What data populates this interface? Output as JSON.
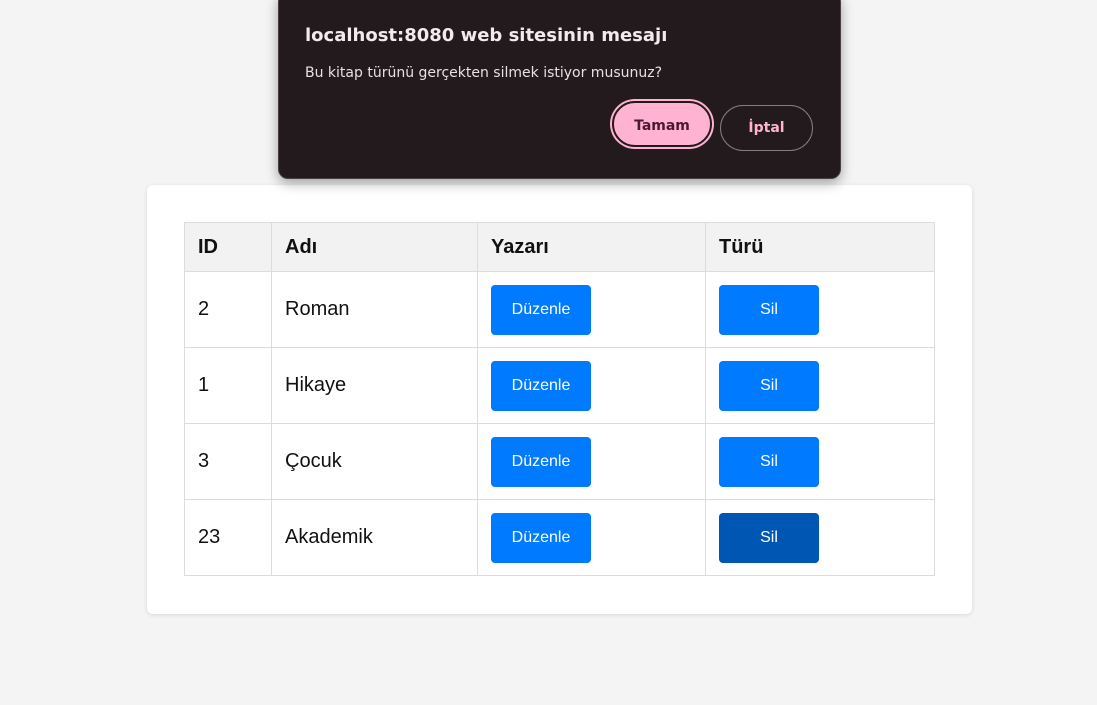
{
  "dialog": {
    "title": "localhost:8080 web sitesinin mesajı",
    "message": "Bu kitap türünü gerçekten silmek istiyor musunuz?",
    "ok_label": "Tamam",
    "cancel_label": "İptal",
    "ok_color": "#ffb3d1",
    "background": "#231a1e"
  },
  "table": {
    "headers": [
      "ID",
      "Adı",
      "Yazarı",
      "Türü"
    ],
    "rows": [
      {
        "id": "2",
        "name": "Roman",
        "edit_label": "Düzenle",
        "delete_label": "Sil"
      },
      {
        "id": "1",
        "name": "Hikaye",
        "edit_label": "Düzenle",
        "delete_label": "Sil"
      },
      {
        "id": "3",
        "name": "Çocuk",
        "edit_label": "Düzenle",
        "delete_label": "Sil"
      },
      {
        "id": "23",
        "name": "Akademik",
        "edit_label": "Düzenle",
        "delete_label": "Sil"
      }
    ]
  },
  "colors": {
    "button_primary": "#007bff",
    "button_hover": "#0056b3",
    "page_background": "#f4f4f4"
  }
}
